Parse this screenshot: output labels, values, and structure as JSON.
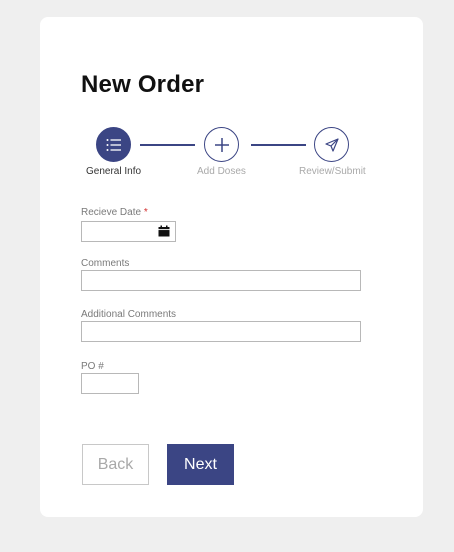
{
  "page": {
    "title": "New Order"
  },
  "stepper": {
    "steps": [
      {
        "label": "General Info",
        "icon": "list-icon",
        "state": "active"
      },
      {
        "label": "Add Doses",
        "icon": "plus-icon",
        "state": "inactive"
      },
      {
        "label": "Review/Submit",
        "icon": "send-icon",
        "state": "inactive"
      }
    ]
  },
  "form": {
    "receive_date": {
      "label": "Recieve Date",
      "required_mark": "*",
      "value": "",
      "icon": "calendar-icon"
    },
    "comments": {
      "label": "Comments",
      "value": ""
    },
    "additional_comments": {
      "label": "Additional Comments",
      "value": ""
    },
    "po_number": {
      "label": "PO #",
      "value": ""
    }
  },
  "actions": {
    "back_label": "Back",
    "next_label": "Next"
  },
  "colors": {
    "primary": "#3b4584",
    "background": "#efefef",
    "card": "#ffffff",
    "required": "#d32f2f"
  }
}
